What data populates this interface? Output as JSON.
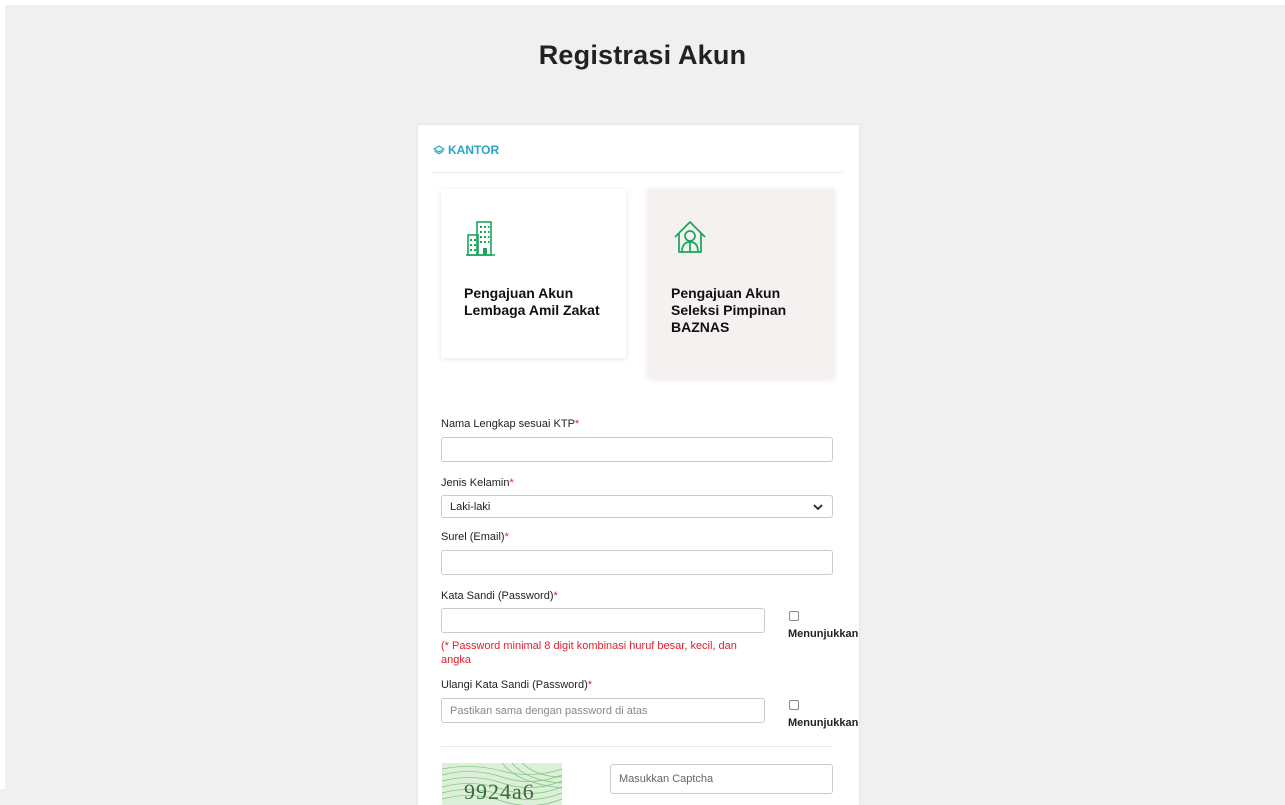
{
  "page": {
    "title": "Registrasi Akun"
  },
  "section": {
    "label": "KANTOR"
  },
  "options": [
    {
      "label": "Pengajuan Akun Lembaga Amil Zakat",
      "icon": "building-icon"
    },
    {
      "label": "Pengajuan Akun Seleksi Pimpinan BAZNAS",
      "icon": "leader-house-icon"
    }
  ],
  "form": {
    "nama": {
      "label": "Nama Lengkap sesuai KTP",
      "value": "",
      "placeholder": ""
    },
    "gender": {
      "label": "Jenis Kelamin",
      "selected": "Laki-laki"
    },
    "email": {
      "label": "Surel (Email)",
      "value": "",
      "placeholder": ""
    },
    "password": {
      "label": "Kata Sandi (Password)",
      "value": "",
      "hint": "(* Password minimal 8 digit kombinasi huruf besar, kecil, dan angka",
      "toggle_label": "Menunjukkan"
    },
    "confirm": {
      "label": "Ulangi Kata Sandi (Password)",
      "placeholder": "Pastikan sama dengan password di atas",
      "toggle_label": "Menunjukkan"
    },
    "required_mark": "*",
    "captcha": {
      "image_text": "9924a6",
      "placeholder": "Masukkan Captcha"
    }
  },
  "colors": {
    "accent": "#25a6c5",
    "icon_green": "#1aa55a",
    "required": "#e0212e",
    "background": "#f0f0f0"
  }
}
